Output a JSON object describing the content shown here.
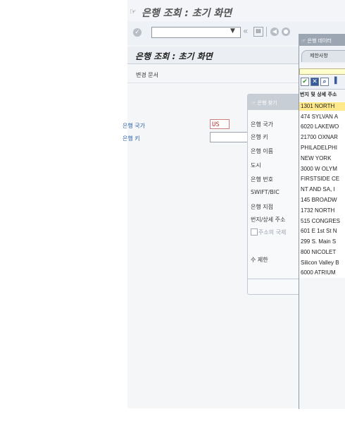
{
  "window": {
    "title": "은행 조회 : 초기 화면"
  },
  "toolbar": {
    "command_field": "",
    "save_icon": "save-icon"
  },
  "screen": {
    "title": "은행 조회 : 초기 화면",
    "app_toolbar": {
      "change_documents": "변경 문서"
    },
    "fields": {
      "country_label": "은행 국가",
      "country_value": "US",
      "key_label": "은행 키",
      "key_value": ""
    }
  },
  "search_dialog": {
    "title": "은행 찾기",
    "rows": [
      "은행 국가",
      "은행 키",
      "은행 이름",
      "도시",
      "은행 번호",
      "SWIFT/BIC",
      "은행 지점",
      "번지/상세 주소",
      "주소의 국제",
      "수 제한"
    ]
  },
  "results_dialog": {
    "title": "은행 데이터",
    "tab_label": "제한사항",
    "column_header": "번지 및 상세 주소",
    "rows": [
      "1301 NORTH",
      "474 SYLVAN A",
      "6020 LAKEWO",
      "21700 OXNAR",
      "PHILADELPHI",
      "NEW YORK",
      "3000 W OLYM",
      "FIRSTSIDE CE",
      "NT AND SA, I",
      "145 BROADW",
      "1732 NORTH",
      "515 CONGRES",
      "601 E 1st St N",
      "299 S. Main S",
      "800 NICOLET",
      "Silicon Valley B",
      "6000 ATRIUM"
    ]
  }
}
